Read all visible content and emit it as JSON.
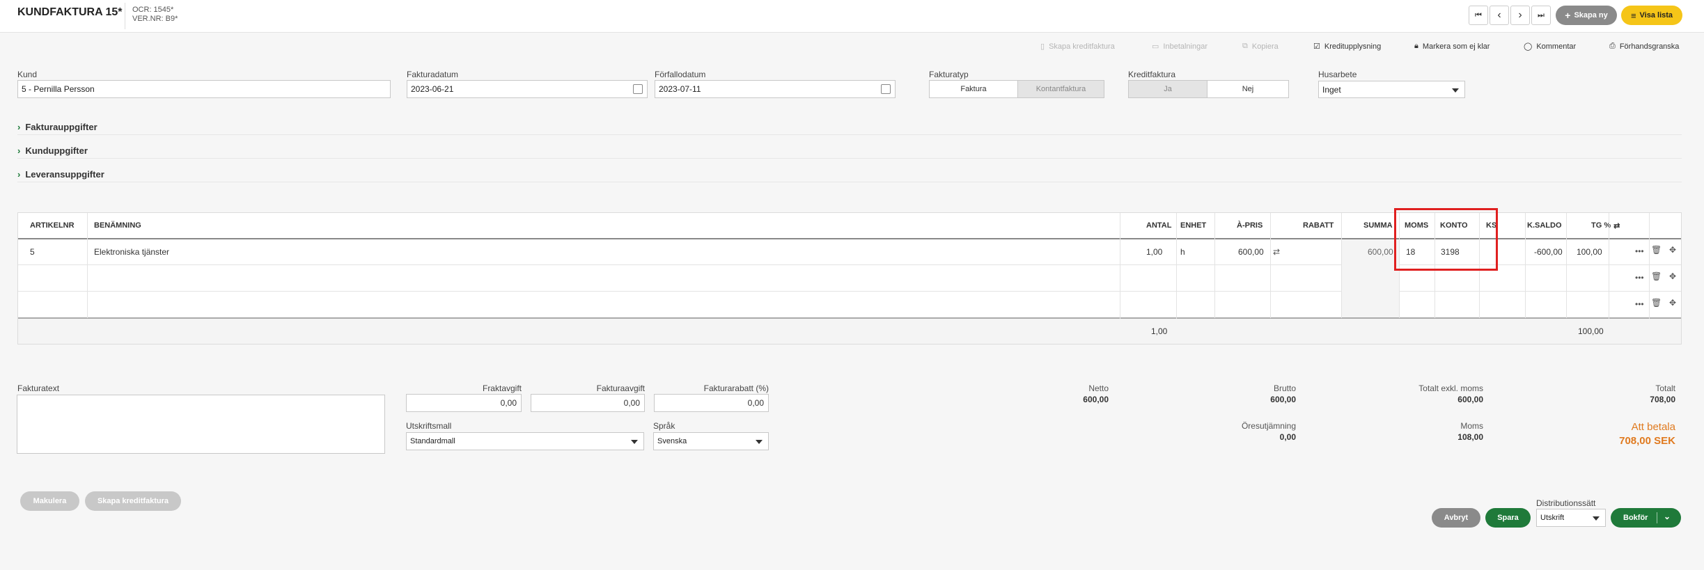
{
  "header": {
    "title": "KUNDFAKTURA 15*",
    "ocr": "OCR: 1545*",
    "ver_nr": "VER.NR: B9*",
    "nav": {
      "first": "⏮",
      "prev": "‹",
      "next": "›",
      "last": "⏭"
    },
    "create_new_label": "Skapa ny",
    "show_list_label": "Visa lista"
  },
  "toolbar": {
    "create_credit": "Skapa kreditfaktura",
    "payments": "Inbetalningar",
    "copy": "Kopiera",
    "credit_check": "Kreditupplysning",
    "mark_not_ready": "Markera som ej klar",
    "comment": "Kommentar",
    "preview": "Förhandsgranska"
  },
  "form": {
    "customer_label": "Kund",
    "customer_value": "5 - Pernilla Persson",
    "invoice_date_label": "Fakturadatum",
    "invoice_date_value": "2023-06-21",
    "due_date_label": "Förfallodatum",
    "due_date_value": "2023-07-11",
    "invoice_type_label": "Fakturatyp",
    "invoice_type_options": [
      "Faktura",
      "Kontantfaktura"
    ],
    "invoice_type_selected": "Kontantfaktura",
    "credit_invoice_label": "Kreditfaktura",
    "credit_invoice_options": [
      "Ja",
      "Nej"
    ],
    "credit_invoice_selected": "Ja",
    "house_work_label": "Husarbete",
    "house_work_value": "Inget"
  },
  "sections": [
    "Fakturauppgifter",
    "Kunduppgifter",
    "Leveransuppgifter"
  ],
  "table": {
    "headers": {
      "artikelnr": "ARTIKELNR",
      "benamning": "BENÄMNING",
      "antal": "ANTAL",
      "enhet": "ENHET",
      "apris": "À-PRIS",
      "rabatt": "RABATT",
      "summa": "SUMMA",
      "moms": "MOMS",
      "konto": "KONTO",
      "ks": "KS",
      "ksaldo": "K.SALDO",
      "tg": "TG %"
    },
    "row1": {
      "artikelnr": "5",
      "benamning": "Elektroniska tjänster",
      "antal": "1,00",
      "enhet": "h",
      "apris": "600,00",
      "summa": "600,00",
      "moms": "18",
      "konto": "3198",
      "ksaldo": "-600,00",
      "tg": "100,00"
    },
    "footer": {
      "antal_total": "1,00",
      "tg_total": "100,00"
    },
    "highlight_color": "#e02020"
  },
  "bottom": {
    "invoice_text_label": "Fakturatext",
    "freight_label": "Fraktavgift",
    "freight_value": "0,00",
    "invoice_fee_label": "Fakturaavgift",
    "invoice_fee_value": "0,00",
    "discount_label": "Fakturarabatt (%)",
    "discount_value": "0,00",
    "print_template_label": "Utskriftsmall",
    "print_template_value": "Standardmall",
    "language_label": "Språk",
    "language_value": "Svenska"
  },
  "totals": {
    "netto_label": "Netto",
    "netto": "600,00",
    "brutto_label": "Brutto",
    "brutto": "600,00",
    "excl_label": "Totalt exkl. moms",
    "excl": "600,00",
    "total_label": "Totalt",
    "total": "708,00",
    "rounding_label": "Öresutjämning",
    "rounding": "0,00",
    "vat_label": "Moms",
    "vat": "108,00",
    "to_pay_label": "Att betala",
    "to_pay": "708,00 SEK",
    "accent": "#e07a1f"
  },
  "actions": {
    "cancel_invoice": "Makulera",
    "create_credit": "Skapa kreditfaktura",
    "abort": "Avbryt",
    "save": "Spara",
    "distribution_label": "Distributionssätt",
    "distribution_value": "Utskrift",
    "book": "Bokför"
  },
  "colors": {
    "green": "#1f7a3a",
    "yellow": "#f5c518",
    "grey_btn": "#8a8a8a"
  }
}
